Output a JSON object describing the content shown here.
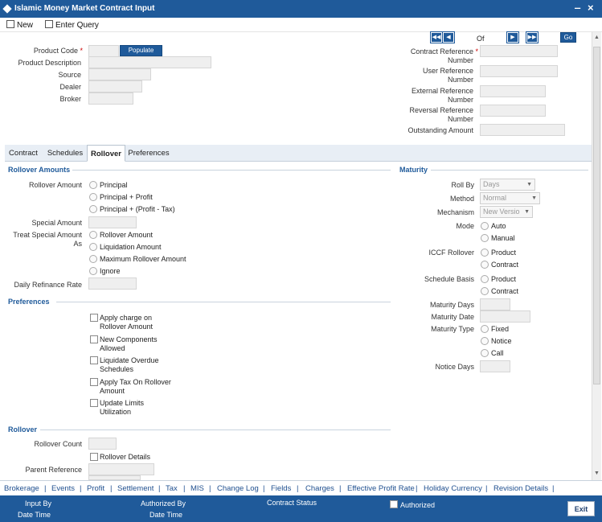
{
  "window": {
    "title": "Islamic Money Market Contract Input",
    "minimize": "‒",
    "close": "×"
  },
  "toolbar": {
    "new_label": "New",
    "enter_query_label": "Enter Query"
  },
  "header": {
    "product_code_label": "Product Code",
    "required_mark": "*",
    "populate_label": "Populate",
    "product_description_label": "Product Description",
    "source_label": "Source",
    "dealer_label": "Dealer",
    "broker_label": "Broker",
    "nav_of_label": "Of",
    "go_label": "Go",
    "contract_ref_label_1": "Contract Reference",
    "contract_ref_label_2": "Number",
    "user_ref_label_1": "User Reference",
    "user_ref_label_2": "Number",
    "external_ref_label_1": "External Reference",
    "external_ref_label_2": "Number",
    "reversal_ref_label_1": "Reversal Reference",
    "reversal_ref_label_2": "Number",
    "outstanding_amount_label": "Outstanding Amount"
  },
  "tabs": [
    {
      "label": "Contract"
    },
    {
      "label": "Schedules"
    },
    {
      "label": "Rollover"
    },
    {
      "label": "Preferences"
    }
  ],
  "rollover_amounts": {
    "section_title": "Rollover Amounts",
    "rollover_amount_label": "Rollover Amount",
    "options": [
      "Principal",
      "Principal + Profit",
      "Principal + (Profit - Tax)"
    ],
    "special_amount_label": "Special Amount",
    "treat_special_label_1": "Treat Special Amount",
    "treat_special_label_2": "As",
    "treat_options": [
      "Rollover Amount",
      "Liquidation Amount",
      "Maximum Rollover Amount",
      "Ignore"
    ],
    "daily_refinance_label": "Daily Refinance Rate"
  },
  "preferences": {
    "section_title": "Preferences",
    "checkboxes": [
      {
        "line1": "Apply charge on",
        "line2": "Rollover Amount"
      },
      {
        "line1": "New Components",
        "line2": "Allowed"
      },
      {
        "line1": "Liquidate Overdue",
        "line2": "Schedules"
      },
      {
        "line1": "Apply Tax On Rollover",
        "line2": "Amount"
      },
      {
        "line1": "Update Limits",
        "line2": "Utilization"
      }
    ]
  },
  "rollover": {
    "section_title": "Rollover",
    "rollover_count_label": "Rollover Count",
    "rollover_details_label": "Rollover Details",
    "parent_reference_label": "Parent Reference"
  },
  "maturity": {
    "section_title": "Maturity",
    "roll_by_label": "Roll By",
    "roll_by_value": "Days",
    "method_label": "Method",
    "method_value": "Normal",
    "mechanism_label": "Mechanism",
    "mechanism_value": "New Versio",
    "mode_label": "Mode",
    "mode_options": [
      "Auto",
      "Manual"
    ],
    "iccf_label": "ICCF Rollover",
    "iccf_options": [
      "Product",
      "Contract"
    ],
    "schedule_basis_label": "Schedule Basis",
    "schedule_basis_options": [
      "Product",
      "Contract"
    ],
    "maturity_days_label": "Maturity Days",
    "maturity_date_label": "Maturity Date",
    "maturity_type_label": "Maturity Type",
    "maturity_type_options": [
      "Fixed",
      "Notice",
      "Call"
    ],
    "notice_days_label": "Notice Days"
  },
  "links": [
    "Brokerage",
    "Events",
    "Profit",
    "Settlement",
    "Tax",
    "MIS",
    "Change Log",
    "Fields",
    "Charges",
    "Effective Profit Rate",
    "Holiday Currency",
    "Revision Details"
  ],
  "link_separator": "|",
  "footer": {
    "input_by": "Input By",
    "date_time_1": "Date Time",
    "authorized_by": "Authorized By",
    "date_time_2": "Date Time",
    "contract_status": "Contract Status",
    "authorized": "Authorized",
    "exit": "Exit"
  }
}
